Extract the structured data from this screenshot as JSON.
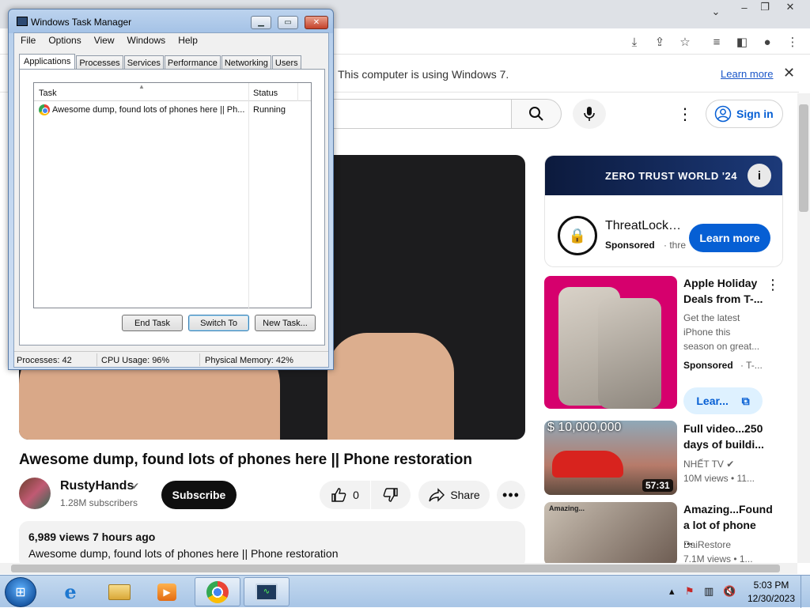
{
  "browser": {
    "toolbar_icons": [
      "download-icon",
      "share-icon",
      "star-icon",
      "reading-list-icon",
      "sidepanel-icon",
      "profile-icon",
      "menu-icon"
    ],
    "infobar": {
      "message": "This computer is using Windows 7.",
      "learn_more": "Learn more",
      "close": "✕"
    }
  },
  "youtube": {
    "sign_in": "Sign in",
    "video": {
      "title": "Awesome dump, found lots of phones here || Phone restoration",
      "channel": "RustyHands",
      "subscribers": "1.28M subscribers",
      "subscribe": "Subscribe",
      "likes": "0",
      "share": "Share",
      "views_time": "6,989 views  7 hours ago",
      "description": "Awesome dump, found lots of phones here || Phone restoration"
    },
    "ad": {
      "banner_title": "ZERO TRUST WORLD '24",
      "info": "i",
      "advertiser": "ThreatLock…",
      "sponsored": "Sponsored",
      "domain": "· thre",
      "cta": "Learn more"
    },
    "recommendations": [
      {
        "title": "Apple Holiday Deals from T-...",
        "description": "Get the latest iPhone this season on great...",
        "sponsored": "Sponsored",
        "advertiser": "· T-...",
        "cta": "Lear..."
      },
      {
        "title": "Full video...250 days of buildi...",
        "overlay": "$ 10,000,000",
        "duration": "57:31",
        "channel": "NHẾT TV",
        "meta": "10M views  • 11..."
      },
      {
        "title": "Amazing...Found a lot of phone ...",
        "thumb_label": "Amazing...",
        "channel": "DaiRestore",
        "meta": "7.1M views  • 1..."
      }
    ]
  },
  "task_manager": {
    "title": "Windows Task Manager",
    "menu": [
      "File",
      "Options",
      "View",
      "Windows",
      "Help"
    ],
    "tabs": [
      "Applications",
      "Processes",
      "Services",
      "Performance",
      "Networking",
      "Users"
    ],
    "active_tab": "Applications",
    "columns": {
      "task": "Task",
      "status": "Status"
    },
    "rows": [
      {
        "task": "Awesome dump, found lots of phones here || Ph...",
        "status": "Running"
      }
    ],
    "buttons": {
      "end_task": "End Task",
      "switch_to": "Switch To",
      "new_task": "New Task..."
    },
    "status": {
      "processes": "Processes: 42",
      "cpu": "CPU Usage: 96%",
      "memory": "Physical Memory: 42%"
    }
  },
  "taskbar": {
    "apps": [
      "ie-icon",
      "explorer-icon",
      "media-player-icon",
      "chrome-icon",
      "task-manager-icon"
    ],
    "time": "5:03 PM",
    "date": "12/30/2023"
  },
  "colors": {
    "youtube_blue": "#065fd4",
    "win7_taskbar": "#a8c5e6"
  }
}
